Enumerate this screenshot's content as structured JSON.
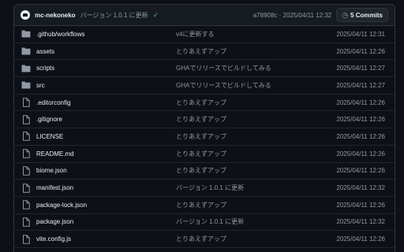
{
  "latest_commit": {
    "author": "mc-nekoneko",
    "message": "バージョン 1.0.1 に更新",
    "sha_date": "a78908c · 2025/04/11 12:32",
    "commits_label": "5 Commits"
  },
  "colors": {
    "folder": "#9198a1",
    "status_ok": "#3fb950"
  },
  "files": [
    {
      "name": ".github/workflows",
      "message": "v4に更新する",
      "date": "2025/04/11 12:31",
      "type": "folder",
      "icon": "folder-icon"
    },
    {
      "name": "assets",
      "message": "とりあえずアップ",
      "date": "2025/04/11 12:26",
      "type": "folder",
      "icon": "folder-icon"
    },
    {
      "name": "scripts",
      "message": "GHAでリリースでビルドしてみる",
      "date": "2025/04/11 12:27",
      "type": "folder",
      "icon": "folder-icon"
    },
    {
      "name": "src",
      "message": "GHAでリリースでビルドしてみる",
      "date": "2025/04/11 12:27",
      "type": "folder",
      "icon": "folder-icon"
    },
    {
      "name": ".editorconfig",
      "message": "とりあえずアップ",
      "date": "2025/04/11 12:26",
      "type": "file",
      "icon": "file-icon"
    },
    {
      "name": ".gitignore",
      "message": "とりあえずアップ",
      "date": "2025/04/11 12:26",
      "type": "file",
      "icon": "file-icon"
    },
    {
      "name": "LICENSE",
      "message": "とりあえずアップ",
      "date": "2025/04/11 12:26",
      "type": "file",
      "icon": "file-icon"
    },
    {
      "name": "README.md",
      "message": "とりあえずアップ",
      "date": "2025/04/11 12:26",
      "type": "file",
      "icon": "file-icon"
    },
    {
      "name": "biome.json",
      "message": "とりあえずアップ",
      "date": "2025/04/11 12:26",
      "type": "file",
      "icon": "file-icon"
    },
    {
      "name": "manifest.json",
      "message": "バージョン 1.0.1 に更新",
      "date": "2025/04/11 12:32",
      "type": "file",
      "icon": "file-icon"
    },
    {
      "name": "package-lock.json",
      "message": "とりあえずアップ",
      "date": "2025/04/11 12:26",
      "type": "file",
      "icon": "file-icon"
    },
    {
      "name": "package.json",
      "message": "バージョン 1.0.1 に更新",
      "date": "2025/04/11 12:32",
      "type": "file",
      "icon": "file-icon"
    },
    {
      "name": "vite.config.js",
      "message": "とりあえずアップ",
      "date": "2025/04/11 12:26",
      "type": "file",
      "icon": "file-icon"
    }
  ]
}
